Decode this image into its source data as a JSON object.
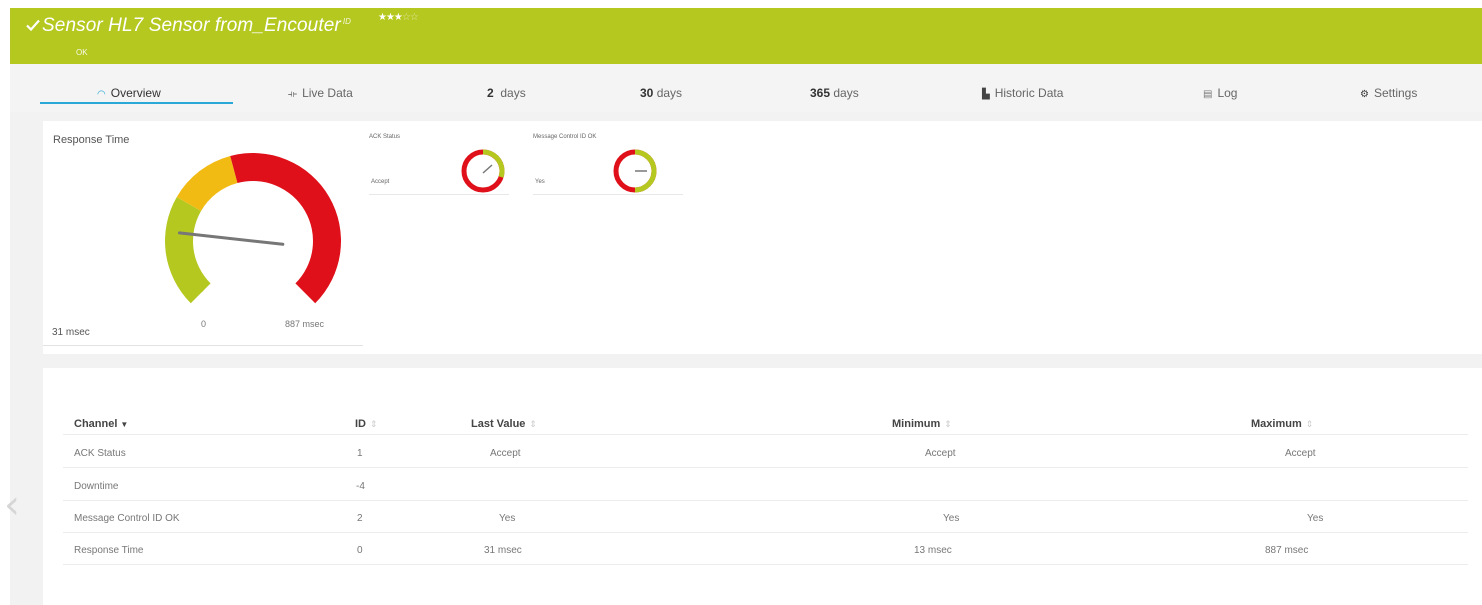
{
  "header": {
    "title": "Sensor HL7 Sensor from_Encouter",
    "title_sup": "ID",
    "status": "OK",
    "rating_stars": "★★★",
    "rating_empty": "☆☆",
    "color": "#b5c820"
  },
  "tabs": [
    {
      "label": "Overview",
      "icon": "gauge-icon",
      "active": true
    },
    {
      "label": "Live Data",
      "icon": "live-data-icon"
    },
    {
      "label_strong": "2",
      "label": "days"
    },
    {
      "label_strong": "30",
      "label": "days"
    },
    {
      "label_strong": "365",
      "label": "days"
    },
    {
      "label": "Historic Data",
      "icon": "chart-icon"
    },
    {
      "label": "Log",
      "icon": "log-icon"
    },
    {
      "label": "Settings",
      "icon": "gear-icon"
    }
  ],
  "gauges": {
    "response_time": {
      "label": "Response Time",
      "value": "31 msec",
      "min_label": "0",
      "max_label": "887 msec",
      "value_number": 31,
      "max_number": 887,
      "colors": {
        "green": "#b5c820",
        "yellow": "#f2bb14",
        "red": "#e0101a"
      }
    },
    "ack_status": {
      "title": "ACK Status",
      "value": "Accept"
    },
    "message_control": {
      "title": "Message Control ID OK",
      "value": "Yes"
    }
  },
  "table": {
    "headers": {
      "channel": "Channel",
      "id": "ID",
      "last_value": "Last Value",
      "minimum": "Minimum",
      "maximum": "Maximum"
    },
    "rows": [
      {
        "channel": "ACK Status",
        "id": "1",
        "last": "Accept",
        "min": "Accept",
        "max": "Accept"
      },
      {
        "channel": "Downtime",
        "id": "-4",
        "last": "",
        "min": "",
        "max": ""
      },
      {
        "channel": "Message Control ID OK",
        "id": "2",
        "last": "Yes",
        "min": "Yes",
        "max": "Yes"
      },
      {
        "channel": "Response Time",
        "id": "0",
        "last": "31 msec",
        "min": "13 msec",
        "max": "887 msec"
      }
    ]
  }
}
